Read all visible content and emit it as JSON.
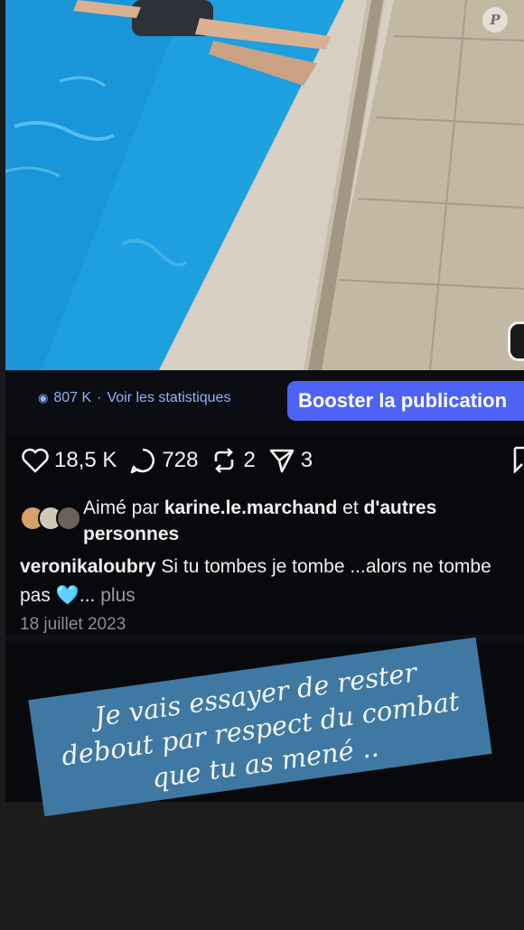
{
  "photo": {
    "watermark": "P"
  },
  "stats": {
    "views": "807 K",
    "separator": "·",
    "stats_link": "Voir les statistiques",
    "boost_label": "Booster la publication"
  },
  "actions": {
    "likes": "18,5 K",
    "comments": "728",
    "reposts": "2",
    "shares": "3"
  },
  "likes": {
    "prefix": "Aimé par",
    "user": "karine.le.marchand",
    "middle": "et",
    "suffix": "d'autres personnes"
  },
  "caption": {
    "user": "veronikaloubry",
    "text": "Si tu tombes je tombe ...alors ne tombe pas",
    "emoji": "🩵",
    "ellipsis": "...",
    "more": "plus"
  },
  "date": "18 juillet 2023",
  "note": {
    "line1": "Je vais essayer de rester",
    "line2": "debout  par respect du combat",
    "line3": "que tu as mené .."
  },
  "colors": {
    "accent": "#4e63f5",
    "note_bg": "#3f79a3",
    "pool": "#1d9fe0",
    "link": "#8fb2ff"
  }
}
